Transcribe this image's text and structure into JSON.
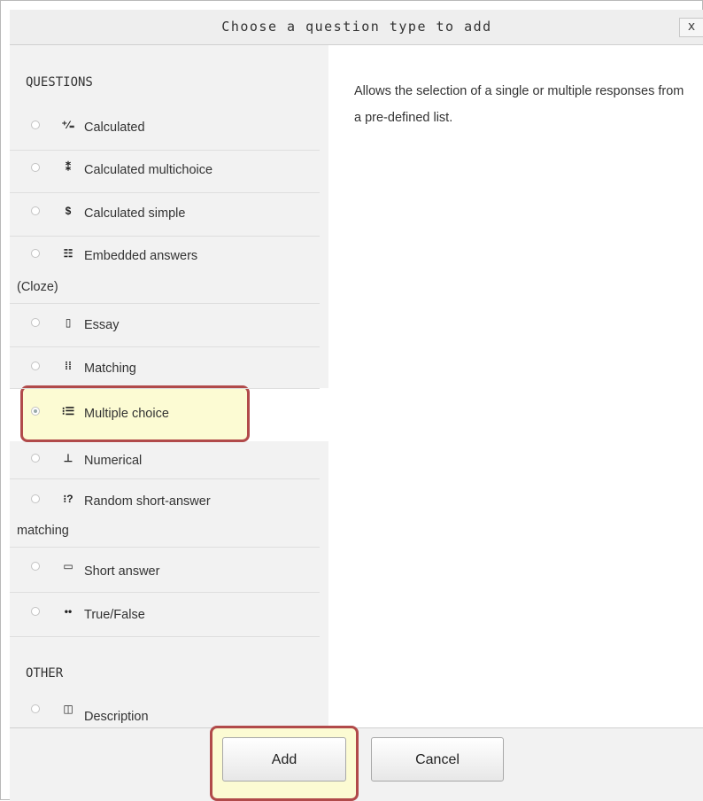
{
  "dialog": {
    "title": "Choose a question type to add",
    "close_label": "x"
  },
  "sections": {
    "questions": "QUESTIONS",
    "other": "OTHER"
  },
  "items": [
    {
      "label": "Calculated",
      "icon": "calculated-icon",
      "selected": false
    },
    {
      "label": "Calculated multichoice",
      "icon": "calculated-multichoice-icon",
      "selected": false
    },
    {
      "label": "Calculated simple",
      "icon": "calculated-simple-icon",
      "selected": false
    },
    {
      "label": "Embedded answers",
      "label2": "(Cloze)",
      "icon": "embedded-answers-icon",
      "selected": false
    },
    {
      "label": "Essay",
      "icon": "essay-icon",
      "selected": false
    },
    {
      "label": "Matching",
      "icon": "matching-icon",
      "selected": false
    },
    {
      "label": "Multiple choice",
      "icon": "multiple-choice-icon",
      "selected": true
    },
    {
      "label": "Numerical",
      "icon": "numerical-icon",
      "selected": false
    },
    {
      "label": "Random short-answer",
      "label2": "matching",
      "icon": "random-short-answer-icon",
      "selected": false
    },
    {
      "label": "Short answer",
      "icon": "short-answer-icon",
      "selected": false
    },
    {
      "label": "True/False",
      "icon": "true-false-icon",
      "selected": false
    }
  ],
  "other_items": [
    {
      "label": "Description",
      "icon": "description-icon",
      "selected": false
    }
  ],
  "description": "Allows the selection of a single or multiple responses from a pre-defined list.",
  "buttons": {
    "add": "Add",
    "cancel": "Cancel"
  },
  "colors": {
    "highlight_border": "#b14a4a",
    "highlight_fill": "#fcfbd3"
  }
}
